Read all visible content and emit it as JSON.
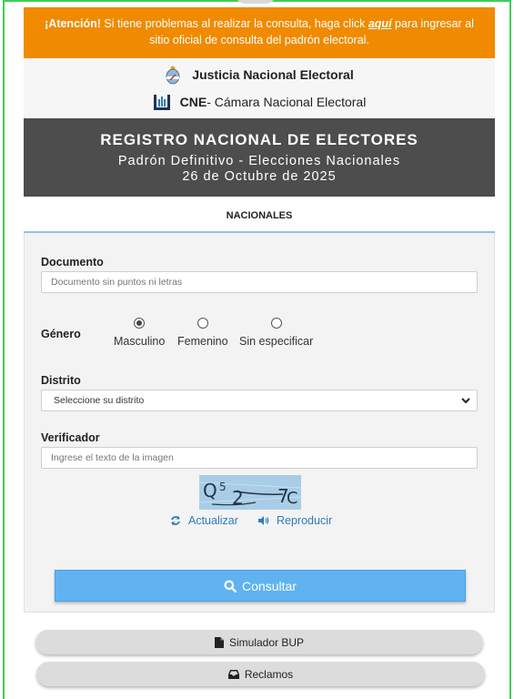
{
  "alert": {
    "attention": "¡Atención!",
    "text_before": " Si tiene problemas al realizar la consulta, haga click ",
    "link": "aquí",
    "text_after": " para ingresar al sitio oficial de consulta del padrón electoral."
  },
  "institutions": {
    "jne": "Justicia Nacional Electoral",
    "cne_abbr": "CNE",
    "cne_rest": " - Cámara Nacional Electoral"
  },
  "banner": {
    "title": "REGISTRO NACIONAL DE ELECTORES",
    "subtitle": "Padrón Definitivo - Elecciones Nacionales",
    "date": "26 de Octubre de 2025"
  },
  "tab": {
    "label": "NACIONALES"
  },
  "form": {
    "documento": {
      "label": "Documento",
      "placeholder": "Documento sin puntos ni letras",
      "value": ""
    },
    "genero": {
      "label": "Género",
      "options": [
        "Masculino",
        "Femenino",
        "Sin especificar"
      ],
      "selected": "Masculino"
    },
    "distrito": {
      "label": "Distrito",
      "selected": "Seleccione su distrito"
    },
    "verificador": {
      "label": "Verificador",
      "placeholder": "Ingrese el texto de la imagen",
      "value": ""
    },
    "captcha_text": "Q5 2 7C",
    "refresh_label": "Actualizar",
    "play_label": "Reproducir",
    "submit_label": "Consultar"
  },
  "buttons": {
    "simulador": "Simulador BUP",
    "reclamos": "Reclamos"
  },
  "colors": {
    "alert": "#f08a00",
    "banner": "#4d4d4d",
    "primary": "#5fb3f0",
    "link": "#2c7bc0",
    "frame": "#3ecf55"
  }
}
